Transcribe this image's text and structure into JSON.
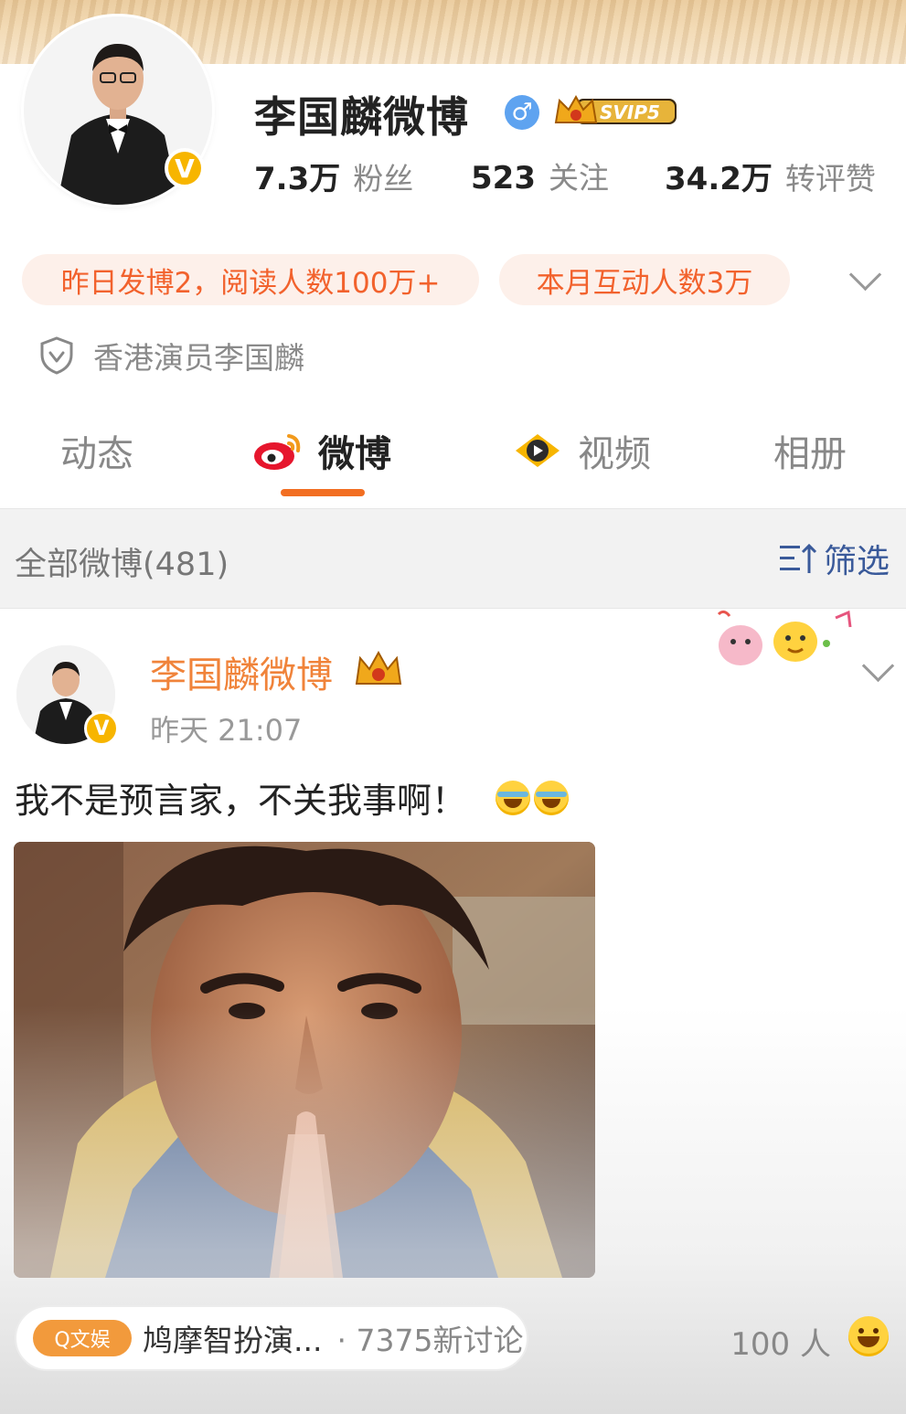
{
  "profile": {
    "name": "李国麟微博",
    "gender_icon": "♂",
    "vip_label": "SVIP5",
    "verified_badge": "V",
    "stats": [
      {
        "num": "7.3万",
        "label": "粉丝"
      },
      {
        "num": "523",
        "label": "关注"
      },
      {
        "num": "34.2万",
        "label": "转评赞"
      }
    ],
    "pills": [
      "昨日发博2，阅读人数100万+",
      "本月互动人数3万"
    ],
    "verification": "香港演员李国麟"
  },
  "tabs": [
    {
      "label": "动态",
      "active": false
    },
    {
      "label": "微博",
      "active": true
    },
    {
      "label": "视频",
      "active": false
    },
    {
      "label": "相册",
      "active": false
    }
  ],
  "feed_header": {
    "all_label": "全部微博(481)",
    "filter_label": "筛选"
  },
  "post": {
    "author": "李国麟微博",
    "time": "昨天 21:07",
    "text": "我不是预言家，不关我事啊！",
    "topic_tag": "Q文娱",
    "topic_title": "鸠摩智扮演...",
    "topic_count": "· 7375新讨论",
    "people_count": "100 人"
  },
  "colors": {
    "accent_orange": "#f26e22",
    "pill_bg": "#fdf0ea",
    "pill_text": "#f2622d",
    "filter_blue": "#3a5a9a",
    "verified_yellow": "#f7b500"
  }
}
